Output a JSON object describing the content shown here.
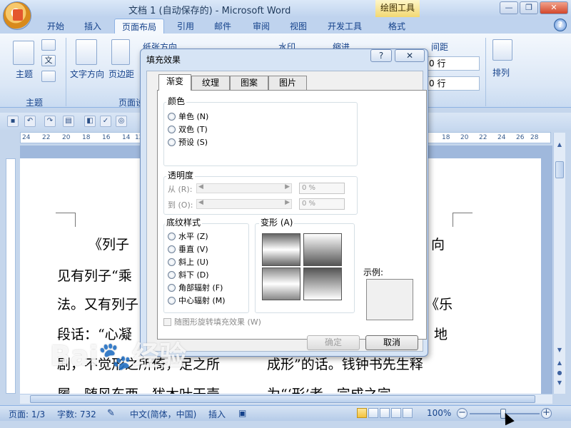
{
  "window": {
    "title": "文档 1 (自动保存的) - Microsoft Word",
    "context_tab_title": "绘图工具"
  },
  "ribbon_tabs": [
    "开始",
    "插入",
    "页面布局",
    "引用",
    "邮件",
    "审阅",
    "视图",
    "开发工具",
    "格式"
  ],
  "active_tab": "页面布局",
  "ribbon": {
    "theme_label": "主题",
    "theme_group_label": "主题",
    "text_direction_label": "文字方向",
    "margins_label": "页边距",
    "page_setup_group_prefix": "页面设",
    "paper_direction_label": "纸张方向",
    "watermark_label": "水印",
    "indent_label": "缩进",
    "spacing_label": "间距",
    "spacing_before": "0 行",
    "spacing_after": "0 行",
    "arrange_label": "排列"
  },
  "ruler": {
    "left_ticks": [
      "24",
      "22",
      "20",
      "18",
      "16",
      "14",
      "12"
    ],
    "right_ticks": [
      "18",
      "20",
      "22",
      "24",
      "26",
      "28",
      "30",
      "32"
    ]
  },
  "document": {
    "line1_left": "《列子",
    "line1_right": "向",
    "line2_left": "见有列子“乘",
    "line3_left": "法。又有列子",
    "line3_right": "《乐",
    "line4_left": "段话：“心凝",
    "line4_right": "地",
    "line5_left": "剧，不觉形之所倚，足之所",
    "line5_right": "成形”的话。钱钟书先生释",
    "line6_left": "履，随风东西，犹木叶干壳",
    "line6_right": "为“‘形’者，完成之完"
  },
  "dialog": {
    "title": "填充效果",
    "help_label": "?",
    "close_label": "✕",
    "tabs": [
      "渐变",
      "纹理",
      "图案",
      "图片"
    ],
    "active_tab": "渐变",
    "color_section": {
      "label": "颜色",
      "options": [
        "单色 (N)",
        "双色 (T)",
        "预设 (S)"
      ]
    },
    "transparency_section": {
      "label": "透明度",
      "from_label": "从 (R):",
      "to_label": "到 (O):",
      "from_value": "0 %",
      "to_value": "0 %"
    },
    "shading_section": {
      "label": "底纹样式",
      "options": [
        "水平 (Z)",
        "垂直 (V)",
        "斜上 (U)",
        "斜下 (D)",
        "角部辐射 (F)",
        "中心辐射 (M)"
      ]
    },
    "variants_label": "变形 (A)",
    "sample_label": "示例:",
    "rotate_checkbox": "随图形旋转填充效果 (W)",
    "ok_label": "确定",
    "cancel_label": "取消"
  },
  "status": {
    "page": "页面: 1/3",
    "word_count": "字数: 732",
    "language": "中文(简体，中国)",
    "mode": "插入",
    "zoom": "100%"
  },
  "zoom_level": 1.0,
  "watermark": {
    "text": "Bai 经验",
    "sub": "jingyan.baidu.com"
  }
}
